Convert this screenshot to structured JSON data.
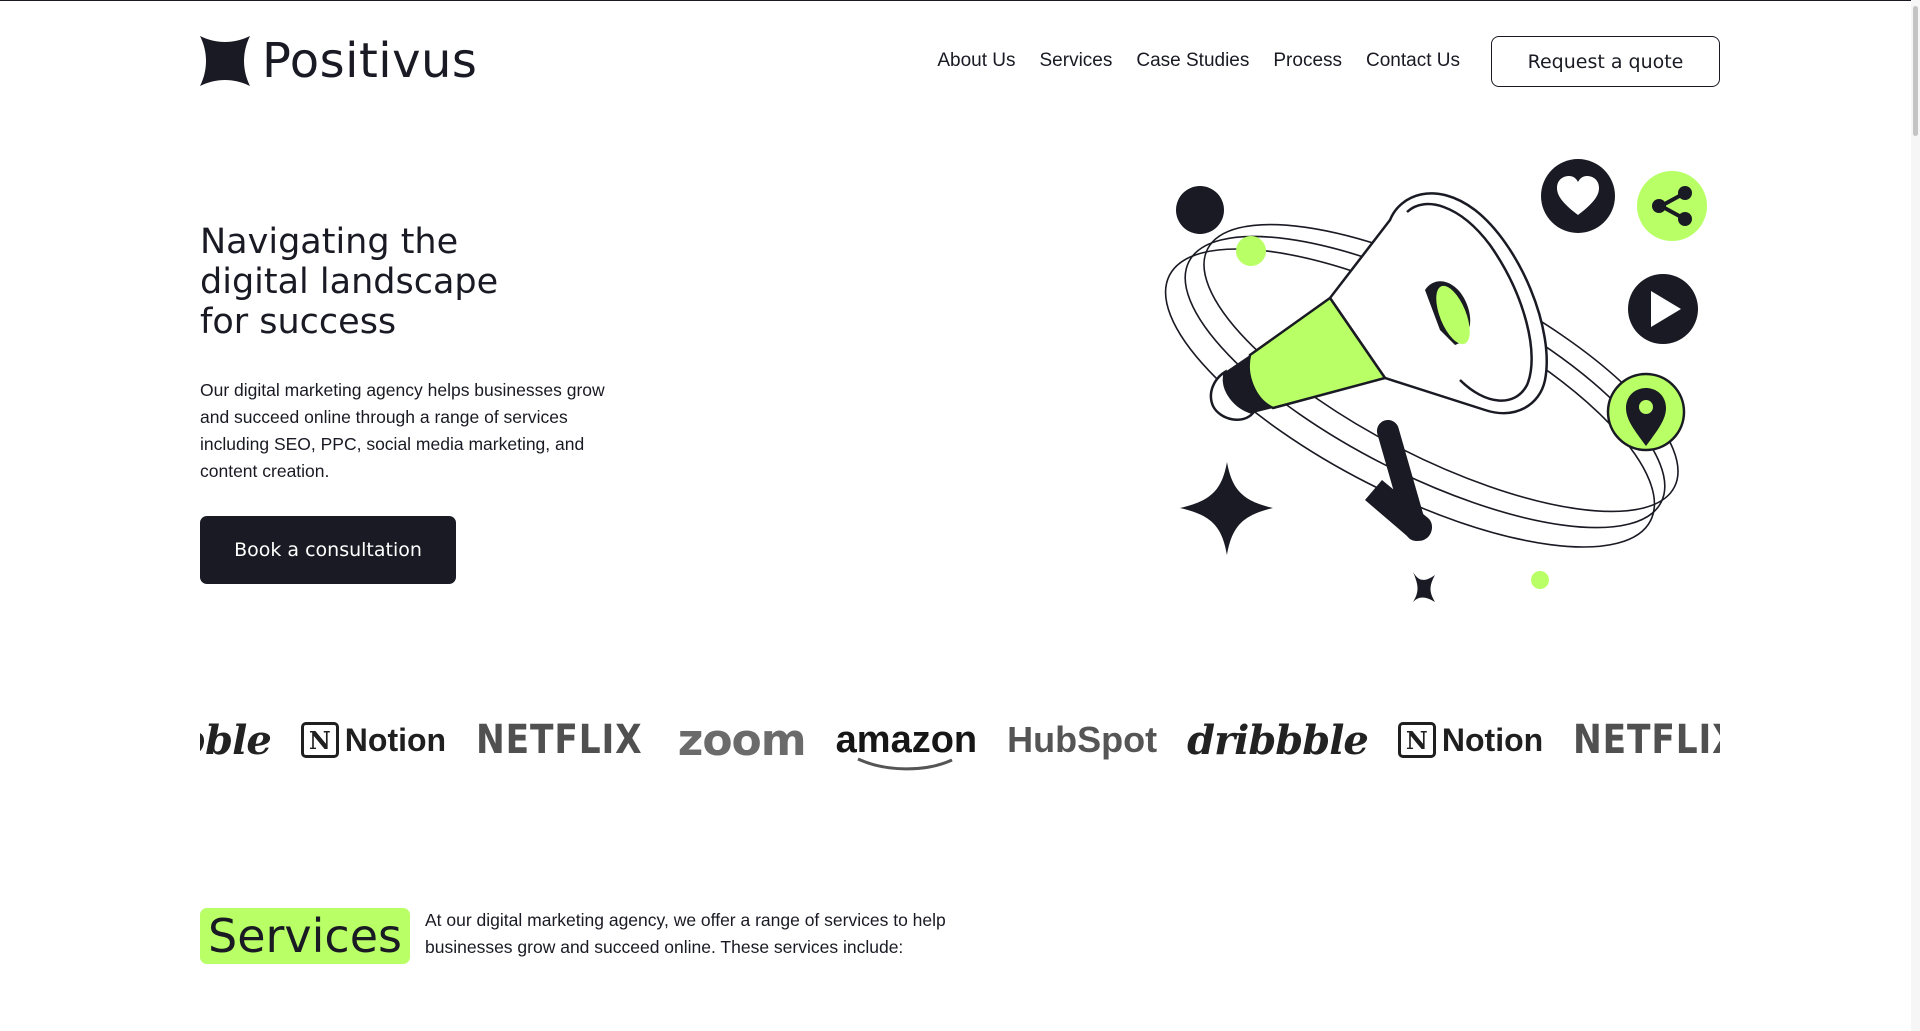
{
  "brand": {
    "name": "Positivus"
  },
  "nav": {
    "items": [
      {
        "label": "About Us"
      },
      {
        "label": "Services"
      },
      {
        "label": "Case Studies"
      },
      {
        "label": "Process"
      },
      {
        "label": "Contact Us"
      }
    ],
    "cta_label": "Request a quote"
  },
  "hero": {
    "title": "Navigating the\ndigital landscape\nfor success",
    "description": "Our digital marketing agency helps businesses grow and succeed online through a range of services including SEO, PPC, social media marketing, and content creation.",
    "cta_label": "Book a consultation",
    "illustration_icons": [
      "megaphone-icon",
      "heart-icon",
      "share-icon",
      "play-icon",
      "location-pin-icon",
      "sparkle-star-icon"
    ]
  },
  "logos": {
    "items": [
      "dribbble",
      "Notion",
      "NETFLIX",
      "zoom",
      "amazon",
      "HubSpot",
      "dribbble",
      "Notion",
      "NETFLIX"
    ]
  },
  "services": {
    "heading": "Services",
    "description": "At our digital marketing agency, we offer a range of services to help businesses grow and succeed online. These services include:"
  },
  "colors": {
    "accent": "#b9ff66",
    "dark": "#191a23",
    "background": "#ffffff"
  }
}
